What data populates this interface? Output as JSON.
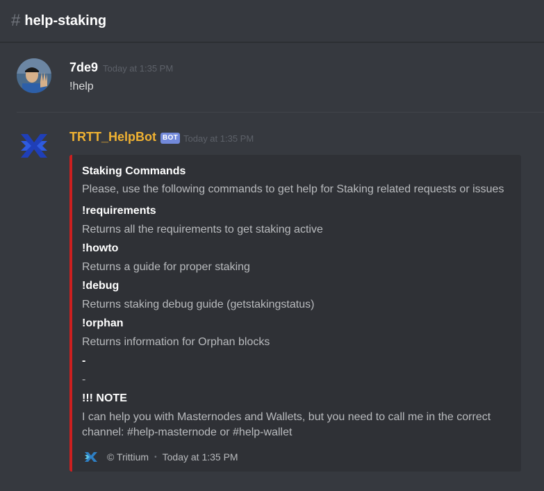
{
  "channel": {
    "hash": "#",
    "name": "help-staking"
  },
  "messages": [
    {
      "author": "7de9",
      "timestamp": "Today at 1:35 PM",
      "text": "!help"
    },
    {
      "author": "TRTT_HelpBot",
      "author_color": "#f0b232",
      "bot_tag": "BOT",
      "timestamp": "Today at 1:35 PM",
      "embed": {
        "color": "#cc1f1f",
        "title": "Staking Commands",
        "description": "Please, use the following commands to get help for Staking related requests or issues",
        "fields": [
          {
            "name": "!requirements",
            "value": "Returns all the requirements to get staking active"
          },
          {
            "name": "!howto",
            "value": "Returns a guide for proper staking"
          },
          {
            "name": "!debug",
            "value": "Returns staking debug guide (getstakingstatus)"
          },
          {
            "name": "!orphan",
            "value": "Returns information for Orphan blocks"
          },
          {
            "name": "-",
            "value": "-"
          },
          {
            "name": "!!! NOTE",
            "value_line1": "I can help you with Masternodes and Wallets, but you need to call me in the correct",
            "value_line2": "channel: #help-masternode or #help-wallet"
          }
        ],
        "footer": {
          "text": "© Trittium",
          "timestamp": "Today at 1:35 PM"
        }
      }
    }
  ]
}
